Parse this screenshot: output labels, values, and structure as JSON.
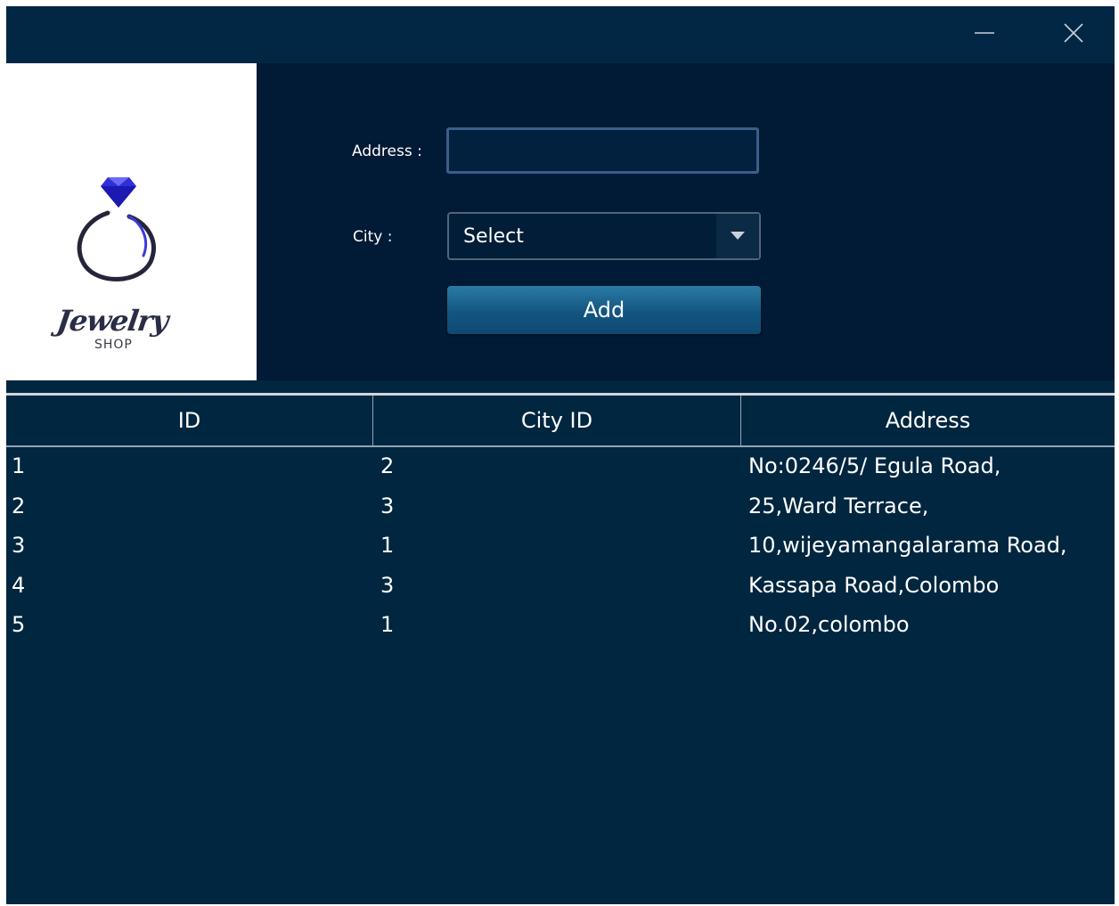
{
  "window": {
    "controls": {
      "minimize_icon": "minimize-icon",
      "close_icon": "close-icon"
    }
  },
  "logo": {
    "icon": "ring-diamond-icon",
    "text_main": "Jewelry",
    "text_sub": "SHOP",
    "diamond_color": "#2f2fd8",
    "ring_color": "#25253a"
  },
  "form": {
    "address_label": "Address :",
    "address_value": "",
    "city_label": "City :",
    "city_selected": "Select",
    "add_label": "Add"
  },
  "table": {
    "columns": [
      "ID",
      "City ID",
      "Address"
    ],
    "rows": [
      [
        "1",
        "2",
        "No:0246/5/ Egula Road,"
      ],
      [
        "2",
        "3",
        "25,Ward Terrace,"
      ],
      [
        "3",
        "1",
        "10,wijeyamangalarama Road,"
      ],
      [
        "4",
        "3",
        "Kassapa Road,Colombo"
      ],
      [
        "5",
        "1",
        "No.02,colombo"
      ]
    ]
  },
  "colors": {
    "window_bg": "#01263f",
    "form_bg": "#011a35",
    "button_accent": "#135580"
  }
}
